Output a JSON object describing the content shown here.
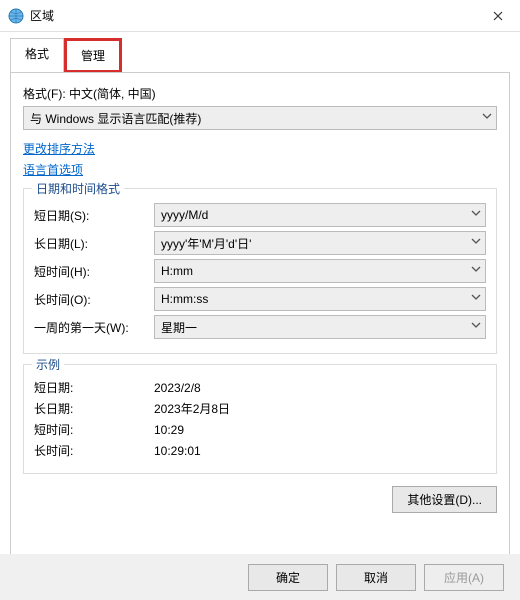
{
  "window": {
    "title": "区域",
    "close": "×"
  },
  "tabs": {
    "format": "格式",
    "admin": "管理"
  },
  "format_section": {
    "label": "格式(F): 中文(简体, 中国)",
    "selected": "与 Windows 显示语言匹配(推荐)"
  },
  "links": {
    "sort": "更改排序方法",
    "lang": "语言首选项"
  },
  "dtformats": {
    "legend": "日期和时间格式",
    "short_date_label": "短日期(S):",
    "short_date_val": "yyyy/M/d",
    "long_date_label": "长日期(L):",
    "long_date_val": "yyyy'年'M'月'd'日'",
    "short_time_label": "短时间(H):",
    "short_time_val": "H:mm",
    "long_time_label": "长时间(O):",
    "long_time_val": "H:mm:ss",
    "first_day_label": "一周的第一天(W):",
    "first_day_val": "星期一"
  },
  "examples": {
    "legend": "示例",
    "short_date_label": "短日期:",
    "short_date_val": "2023/2/8",
    "long_date_label": "长日期:",
    "long_date_val": "2023年2月8日",
    "short_time_label": "短时间:",
    "short_time_val": "10:29",
    "long_time_label": "长时间:",
    "long_time_val": "10:29:01"
  },
  "buttons": {
    "other": "其他设置(D)...",
    "ok": "确定",
    "cancel": "取消",
    "apply": "应用(A)"
  }
}
